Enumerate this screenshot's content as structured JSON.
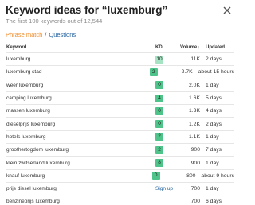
{
  "dialog": {
    "title": "Keyword ideas for “luxemburg”",
    "subtitle": "The first 100 keywords out of 12,544"
  },
  "tabs": {
    "phrase_match": "Phrase match",
    "separator": "/",
    "questions": "Questions"
  },
  "table": {
    "headers": {
      "keyword": "Keyword",
      "kd": "KD",
      "volume": "Volume",
      "volume_sort": "↓",
      "updated": "Updated"
    },
    "rows": [
      {
        "keyword": "luxemburg",
        "kd": "10",
        "volume": "11K",
        "updated": "2 days",
        "kd_style": "light"
      },
      {
        "keyword": "luxemburg stad",
        "kd": "2",
        "volume": "2.7K",
        "updated": "about 15 hours",
        "kd_style": "dark"
      },
      {
        "keyword": "weer luxemburg",
        "kd": "0",
        "volume": "2.0K",
        "updated": "1 day",
        "kd_style": "dark"
      },
      {
        "keyword": "camping luxemburg",
        "kd": "4",
        "volume": "1.6K",
        "updated": "5 days",
        "kd_style": "dark"
      },
      {
        "keyword": "massen luxemburg",
        "kd": "0",
        "volume": "1.3K",
        "updated": "4 days",
        "kd_style": "dark"
      },
      {
        "keyword": "dieselprijs luxemburg",
        "kd": "0",
        "volume": "1.2K",
        "updated": "2 days",
        "kd_style": "dark"
      },
      {
        "keyword": "hotels luxemburg",
        "kd": "2",
        "volume": "1.1K",
        "updated": "1 day",
        "kd_style": "dark"
      },
      {
        "keyword": "groothertogdom luxemburg",
        "kd": "2",
        "volume": "900",
        "updated": "7 days",
        "kd_style": "dark"
      },
      {
        "keyword": "klein zwitserland luxemburg",
        "kd": "8",
        "volume": "900",
        "updated": "1 day",
        "kd_style": "dark"
      },
      {
        "keyword": "knauf luxemburg",
        "kd": "0",
        "volume": "800",
        "updated": "about 9 hours",
        "kd_style": "dark"
      },
      {
        "keyword": "prijs diesel luxemburg",
        "kd": "",
        "signup": "Sign up",
        "volume": "700",
        "updated": "1 day",
        "kd_style": "none"
      },
      {
        "keyword": "benzineprijs luxemburg",
        "kd": "",
        "volume": "700",
        "updated": "6 days",
        "kd_style": "none"
      }
    ]
  },
  "icons": {
    "close": "close-icon"
  },
  "colors": {
    "phrase_match": "#f08a24",
    "questions_link": "#1f5f9e",
    "kd_low": "#4fc48a",
    "kd_light": "#a6e3c3"
  }
}
